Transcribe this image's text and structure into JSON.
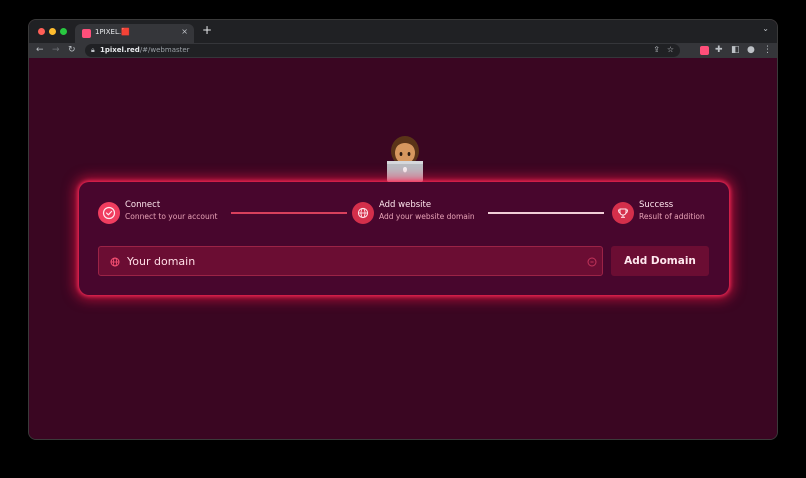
{
  "browser": {
    "tab_title": "1PIXEL.🟥",
    "tab_close": "×",
    "new_tab": "+",
    "url_host": "1pixel.red",
    "url_path": "/#/webmaster"
  },
  "steps": [
    {
      "title": "Connect",
      "subtitle": "Connect to your account",
      "icon": "check-circle-icon",
      "status": "done"
    },
    {
      "title": "Add website",
      "subtitle": "Add your website domain",
      "icon": "globe-icon",
      "status": "active"
    },
    {
      "title": "Success",
      "subtitle": "Result of addition",
      "icon": "trophy-icon",
      "status": "pending"
    }
  ],
  "form": {
    "domain_placeholder": "Your domain",
    "domain_value": "",
    "submit_label": "Add Domain"
  },
  "colors": {
    "page_background": "#3a0622",
    "card_background": "#48062d",
    "accent": "#f03d5f",
    "glow": "#ff1646",
    "input_background": "#6b0d33"
  }
}
